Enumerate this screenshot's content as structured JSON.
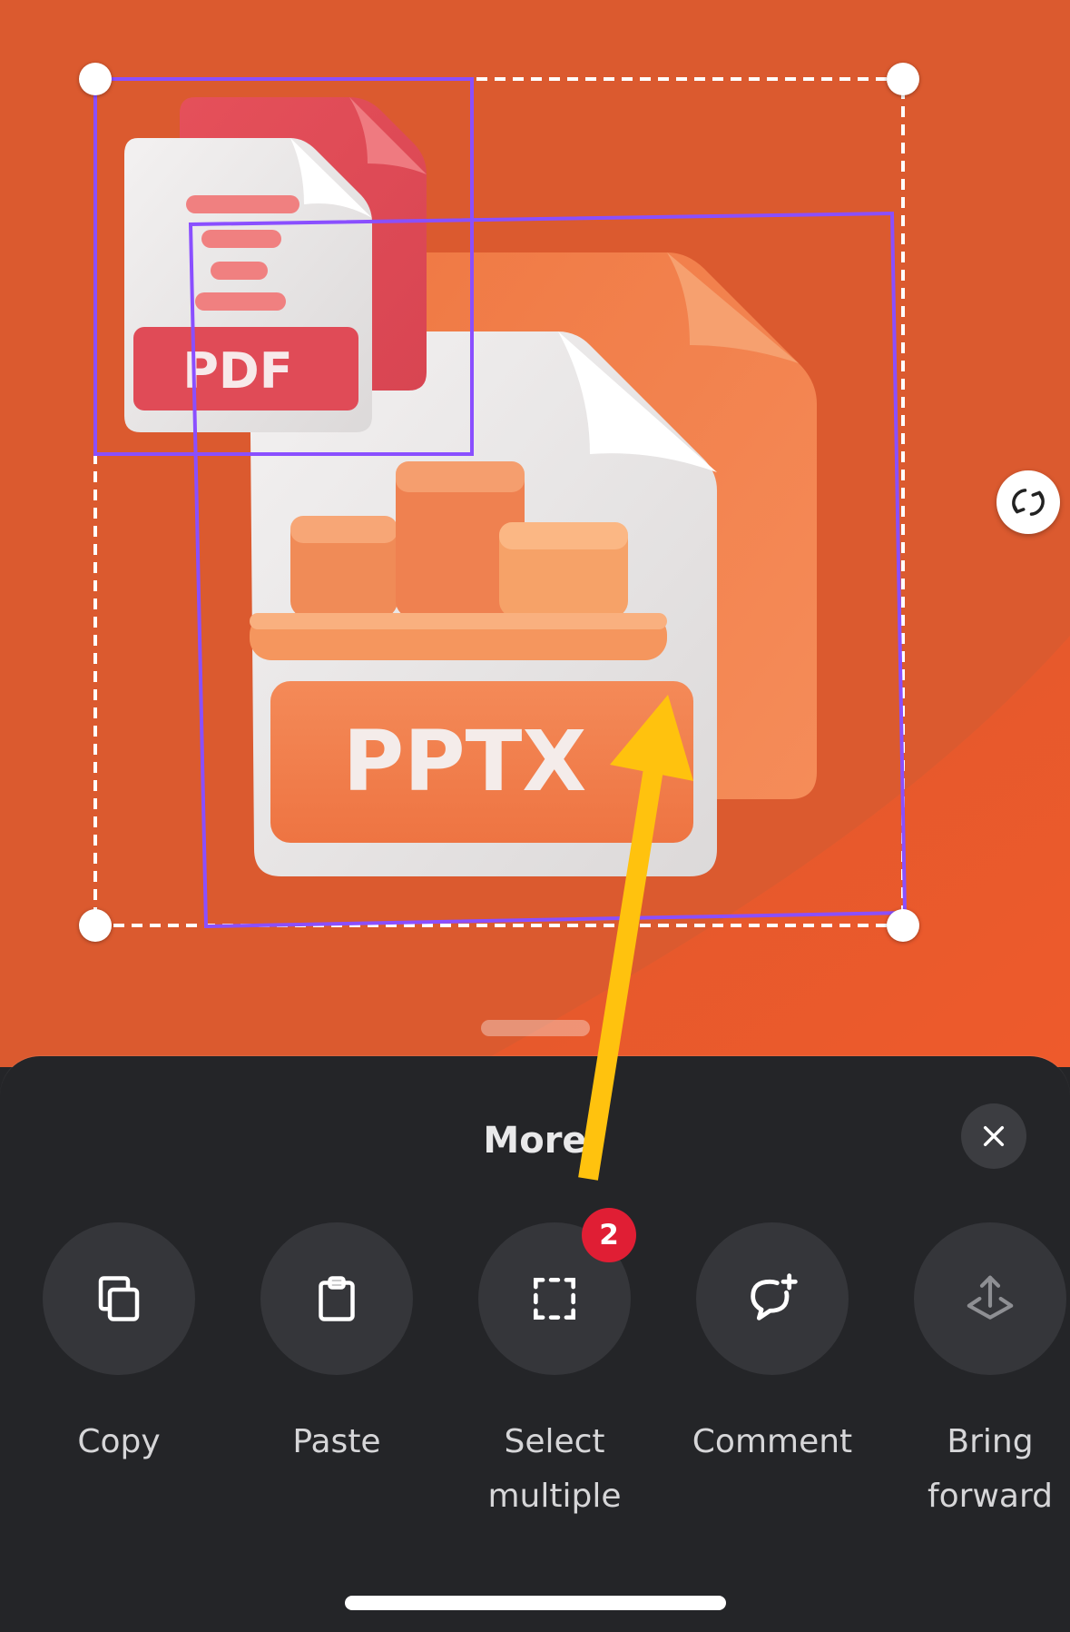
{
  "canvas": {
    "pdf_label": "PDF",
    "pptx_label": "PPTX",
    "rotate_icon": "rotate-icon"
  },
  "sheet": {
    "title": "More",
    "close_icon": "close-icon",
    "actions": [
      {
        "label_line1": "Copy",
        "label_line2": "",
        "icon": "copy-icon"
      },
      {
        "label_line1": "Paste",
        "label_line2": "",
        "icon": "clipboard-icon"
      },
      {
        "label_line1": "Select",
        "label_line2": "multiple",
        "icon": "select-multiple-icon",
        "badge": "2"
      },
      {
        "label_line1": "Comment",
        "label_line2": "",
        "icon": "comment-add-icon"
      },
      {
        "label_line1": "Bring",
        "label_line2": "forward",
        "icon": "bring-forward-icon"
      }
    ]
  },
  "colors": {
    "canvas_background": "#db5a2f",
    "selection_outline": "#8a4fff",
    "badge": "#e01e34",
    "sheet_background": "#242528",
    "annotation_arrow": "#ffc20e"
  }
}
